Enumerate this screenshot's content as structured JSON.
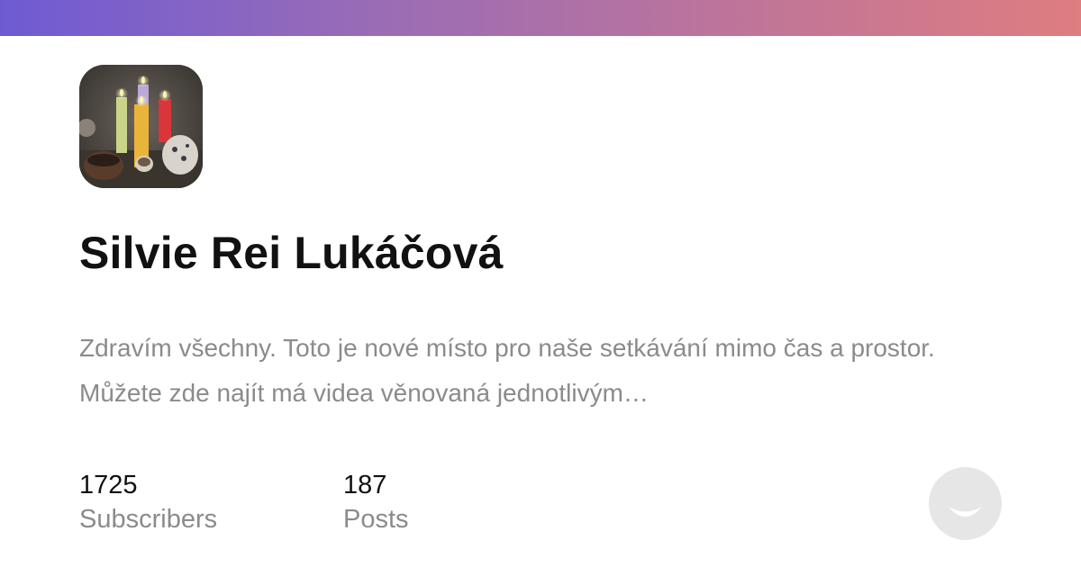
{
  "brand": {
    "gradient_start": "#6e5bd3",
    "gradient_end": "#df7d80"
  },
  "profile": {
    "avatar_icon": "candles-photo",
    "name": "Silvie Rei Lukáčová",
    "description": "Zdravím všechny. Toto je nové místo pro naše setkávání mimo čas a prostor. Můžete zde najít má videa věnovaná jednotlivým…"
  },
  "stats": {
    "subscribers": {
      "value": "1725",
      "label": "Subscribers"
    },
    "posts": {
      "value": "187",
      "label": "Posts"
    }
  },
  "footer": {
    "logo_icon": "smiley-icon",
    "logo_color": "#e6e6e6"
  }
}
